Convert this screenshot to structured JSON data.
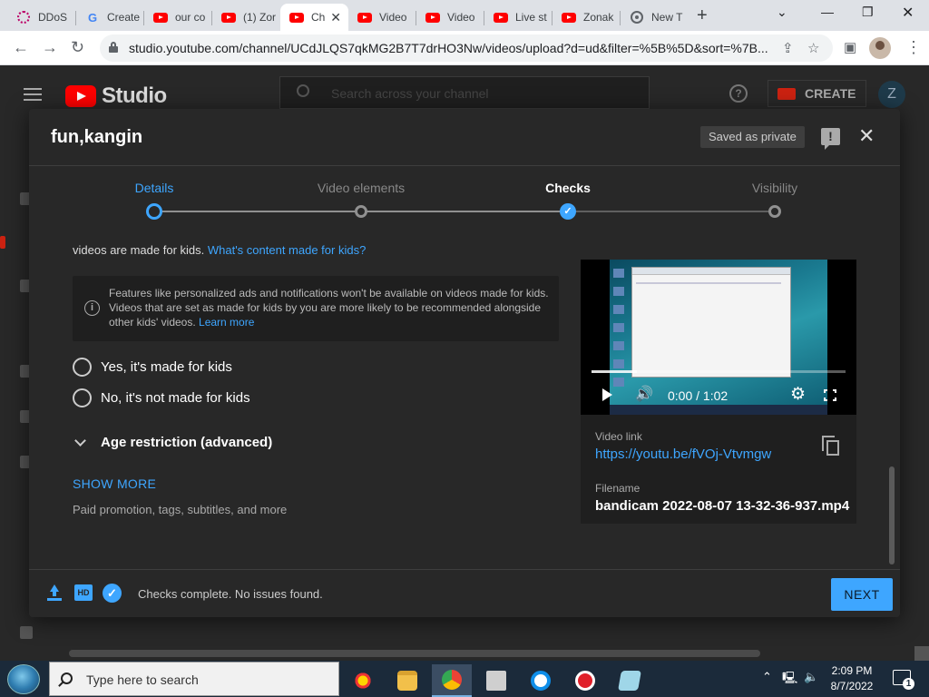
{
  "browser": {
    "tabs": [
      {
        "label": "DDoS",
        "icon": "ddos-icon"
      },
      {
        "label": "Create",
        "icon": "google-icon"
      },
      {
        "label": "our co",
        "icon": "youtube-icon"
      },
      {
        "label": "(1) Zor",
        "icon": "youtube-icon"
      },
      {
        "label": "Ch",
        "icon": "youtube-icon",
        "active": true
      },
      {
        "label": "Video",
        "icon": "youtube-icon"
      },
      {
        "label": "Video",
        "icon": "youtube-icon"
      },
      {
        "label": "Live st",
        "icon": "youtube-icon"
      },
      {
        "label": "Zonak",
        "icon": "youtube-icon"
      },
      {
        "label": "New T",
        "icon": "chrome-icon"
      }
    ],
    "url": "studio.youtube.com/channel/UCdJLQS7qkMG2B7T7drHO3Nw/videos/upload?d=ud&filter=%5B%5D&sort=%7B..."
  },
  "studio": {
    "logo_text": "Studio",
    "search_placeholder": "Search across your channel",
    "create_label": "CREATE",
    "avatar_letter": "Z"
  },
  "modal": {
    "title": "fun,kangin",
    "saved_status": "Saved as private",
    "steps": [
      {
        "label": "Details",
        "state": "active"
      },
      {
        "label": "Video elements",
        "state": "todo"
      },
      {
        "label": "Checks",
        "state": "done"
      },
      {
        "label": "Visibility",
        "state": "todo"
      }
    ],
    "kids_text": "videos are made for kids.",
    "kids_link": "What's content made for kids?",
    "notice_text": "Features like personalized ads and notifications won't be available on videos made for kids. Videos that are set as made for kids by you are more likely to be recommended alongside other kids' videos.",
    "notice_link": "Learn more",
    "radio_yes": "Yes, it's made for kids",
    "radio_no": "No, it's not made for kids",
    "age_restriction": "Age restriction (advanced)",
    "show_more": "SHOW MORE",
    "show_more_sub": "Paid promotion, tags, subtitles, and more",
    "preview": {
      "time": "0:00 / 1:02",
      "progress": 0.18,
      "video_link_label": "Video link",
      "video_link": "https://youtu.be/fVOj-Vtvmgw",
      "filename_label": "Filename",
      "filename": "bandicam 2022-08-07 13-32-36-937.mp4"
    },
    "footer_status": "Checks complete. No issues found.",
    "next_label": "NEXT"
  },
  "taskbar": {
    "search_placeholder": "Type here to search",
    "time": "2:09 PM",
    "date": "8/7/2022",
    "notification_count": "1"
  },
  "colors": {
    "accent": "#3ea6ff",
    "surface": "#282828",
    "brand_red": "#ff0000"
  }
}
